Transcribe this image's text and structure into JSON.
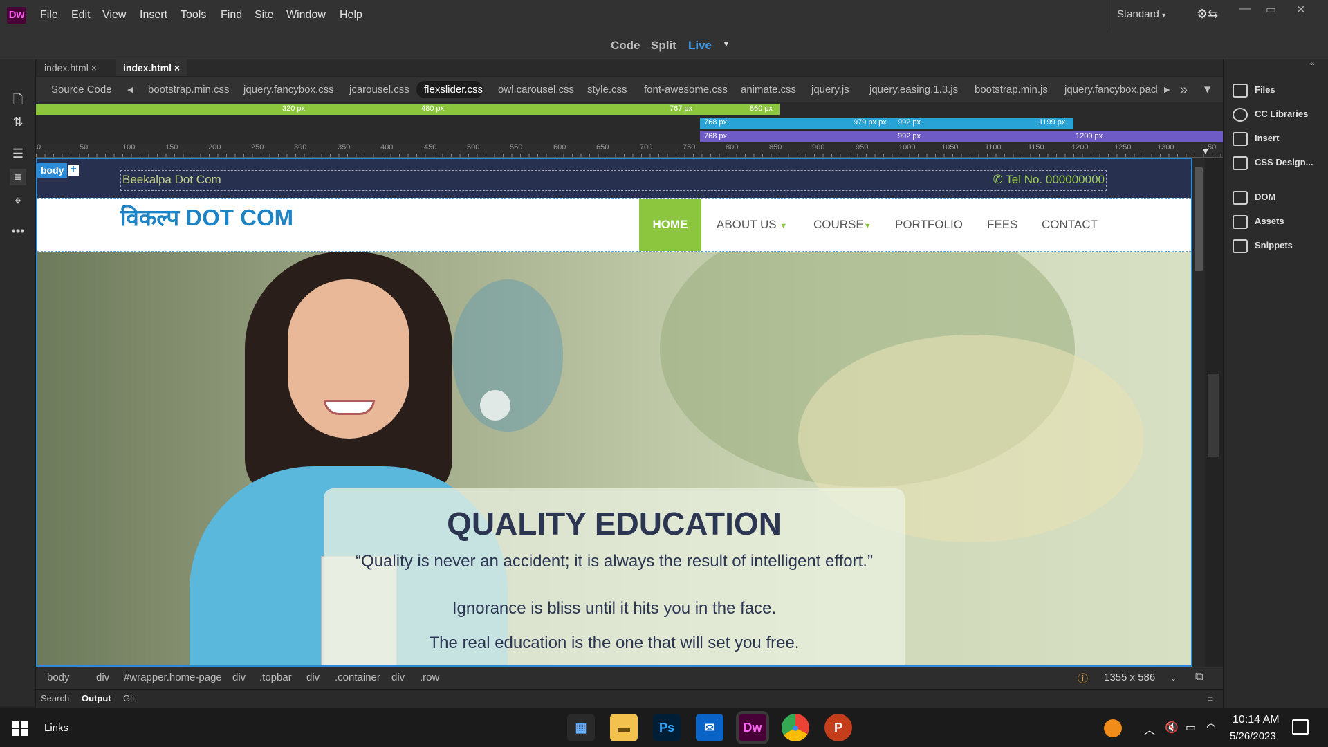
{
  "app": {
    "logo": "Dw"
  },
  "menu": [
    "File",
    "Edit",
    "View",
    "Insert",
    "Tools",
    "Find",
    "Site",
    "Window",
    "Help"
  ],
  "workspace": "Standard",
  "views": {
    "code": "Code",
    "split": "Split",
    "live": "Live"
  },
  "doc_tabs": [
    {
      "label": "index.html",
      "close": "×"
    },
    {
      "label": "index.html",
      "close": "×"
    }
  ],
  "related_files": [
    "Source Code",
    "bootstrap.min.css",
    "jquery.fancybox.css",
    "jcarousel.css",
    "flexslider.css",
    "owl.carousel.css",
    "style.css",
    "font-awesome.css",
    "animate.css",
    "jquery.js",
    "jquery.easing.1.3.js",
    "bootstrap.min.js",
    "jquery.fancybox.pack"
  ],
  "media_queries": {
    "max": [
      "320 px",
      "480 px",
      "767 px",
      "860 px"
    ],
    "row2": [
      "768 px",
      "979 px px",
      "992 px",
      "1199 px"
    ],
    "row3": [
      "768 px",
      "992 px",
      "1200 px"
    ]
  },
  "ruler_labels": [
    "0",
    "50",
    "100",
    "150",
    "200",
    "250",
    "300",
    "350",
    "400",
    "450",
    "500",
    "550",
    "600",
    "650",
    "700",
    "750",
    "800",
    "850",
    "900",
    "950",
    "1000",
    "1050",
    "1100",
    "1150",
    "1200",
    "1250",
    "1300",
    "50"
  ],
  "live": {
    "badge": "body",
    "badge_plus": "+",
    "topbar_name": "Beekalpa Dot Com",
    "tel": "Tel No. 000000000",
    "brand": "विकल्प DOT COM",
    "nav": [
      {
        "label": "HOME"
      },
      {
        "label": "ABOUT US"
      },
      {
        "label": "COURSE"
      },
      {
        "label": "PORTFOLIO"
      },
      {
        "label": "FEES"
      },
      {
        "label": "CONTACT"
      }
    ],
    "hero_title": "QUALITY EDUCATION",
    "hero_lines": [
      "“Quality is never an accident; it is always the result of intelligent effort.”",
      "Ignorance is bliss until it hits you in the face.",
      "The real education is the one that will set you free."
    ]
  },
  "tag_selector": [
    "body",
    "div",
    "#wrapper.home-page",
    "div",
    ".topbar",
    "div",
    ".container",
    "div",
    ".row"
  ],
  "window_size": "1355 x 586",
  "panel_tabs": [
    "Search",
    "Output",
    "Git"
  ],
  "right_panels": [
    "Files",
    "CC Libraries",
    "Insert",
    "CSS Design...",
    "DOM",
    "Assets",
    "Snippets"
  ],
  "taskbar": {
    "links": "Links",
    "time": "10:14 AM",
    "date": "5/26/2023"
  },
  "colors": {
    "accent": "#2b8bd6",
    "nav_active": "#8cc63f",
    "topbar": "#27314f",
    "brand": "#1d84c6"
  }
}
